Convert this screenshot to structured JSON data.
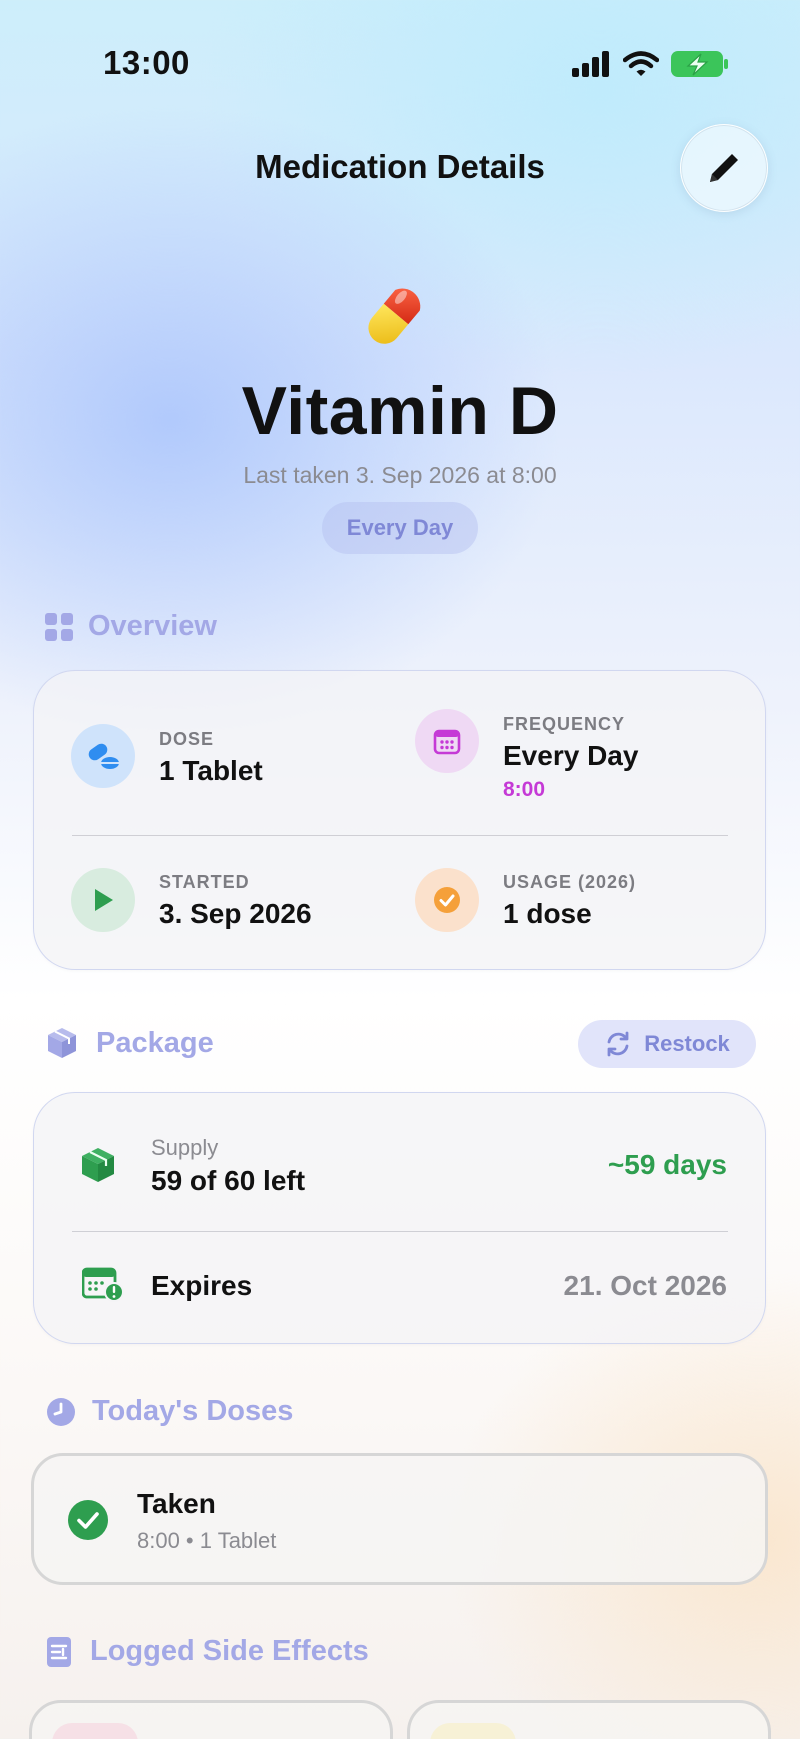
{
  "status_bar": {
    "time": "13:00"
  },
  "header": {
    "title": "Medication Details",
    "edit_icon": "pencil-icon"
  },
  "medication": {
    "emoji_icon": "pill-icon",
    "name": "Vitamin D",
    "last_taken": "Last taken 3. Sep 2026 at 8:00",
    "frequency_pill": "Every Day"
  },
  "overview": {
    "title": "Overview",
    "dose": {
      "label": "DOSE",
      "value": "1 Tablet"
    },
    "frequency": {
      "label": "FREQUENCY",
      "value": "Every Day",
      "time": "8:00"
    },
    "started": {
      "label": "STARTED",
      "value": "3. Sep 2026"
    },
    "usage": {
      "label": "USAGE (2026)",
      "value": "1 dose"
    }
  },
  "package": {
    "title": "Package",
    "restock_label": "Restock",
    "supply_label": "Supply",
    "supply_value": "59 of 60 left",
    "supply_days": "~59 days",
    "expires_label": "Expires",
    "expires_value": "21. Oct 2026"
  },
  "todays_doses": {
    "title": "Today's Doses",
    "items": [
      {
        "status": "Taken",
        "detail": "8:00 • 1 Tablet"
      }
    ]
  },
  "side_effects": {
    "title": "Logged Side Effects"
  },
  "colors": {
    "accent": "#a3a8e6",
    "green": "#2e9e4f",
    "purple": "#c53ad6",
    "orange": "#f5a03a",
    "blue": "#2f8df0"
  }
}
